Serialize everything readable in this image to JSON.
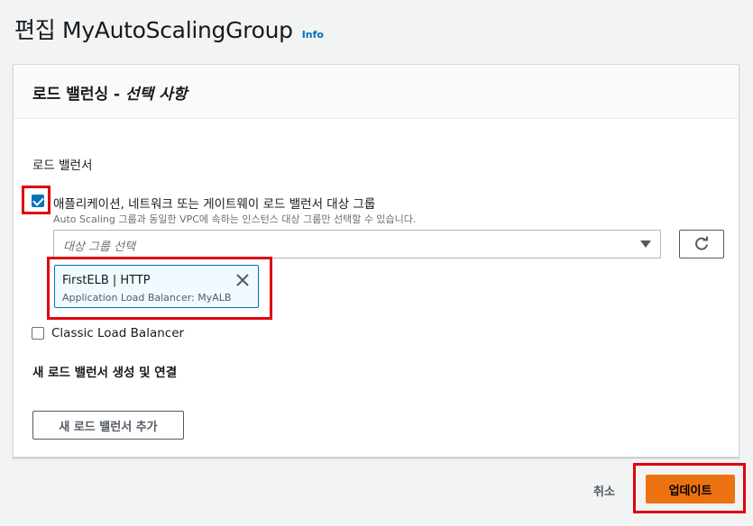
{
  "header": {
    "title": "편집 MyAutoScalingGroup",
    "info_label": "Info"
  },
  "panel": {
    "title_main": "로드 밸런싱 - ",
    "title_optional": "선택 사항",
    "section_label": "로드 밸런서",
    "option_app": {
      "label": "애플리케이션, 네트워크 또는 게이트웨이 로드 밸런서 대상 그룹",
      "description": "Auto Scaling 그룹과 동일한 VPC에 속하는 인스턴스 대상 그룹만 선택할 수 있습니다.",
      "checked": true
    },
    "target_group_select": {
      "placeholder": "대상 그룹 선택"
    },
    "selected_token": {
      "title": "FirstELB | HTTP",
      "subtitle": "Application Load Balancer: MyALB"
    },
    "option_classic": {
      "label": "Classic Load Balancer",
      "checked": false
    },
    "new_lb_heading": "새 로드 밸런서 생성 및 연결",
    "add_button_label": "새 로드 밸런서 추가"
  },
  "footer": {
    "cancel_label": "취소",
    "update_label": "업데이트"
  },
  "colors": {
    "primary_button": "#ec7211",
    "link": "#0073bb",
    "checkbox": "#0073bb",
    "highlight_box": "#e00010"
  },
  "icons": {
    "refresh": "refresh-icon",
    "dropdown": "caret-down-icon",
    "token_remove": "close-icon"
  }
}
